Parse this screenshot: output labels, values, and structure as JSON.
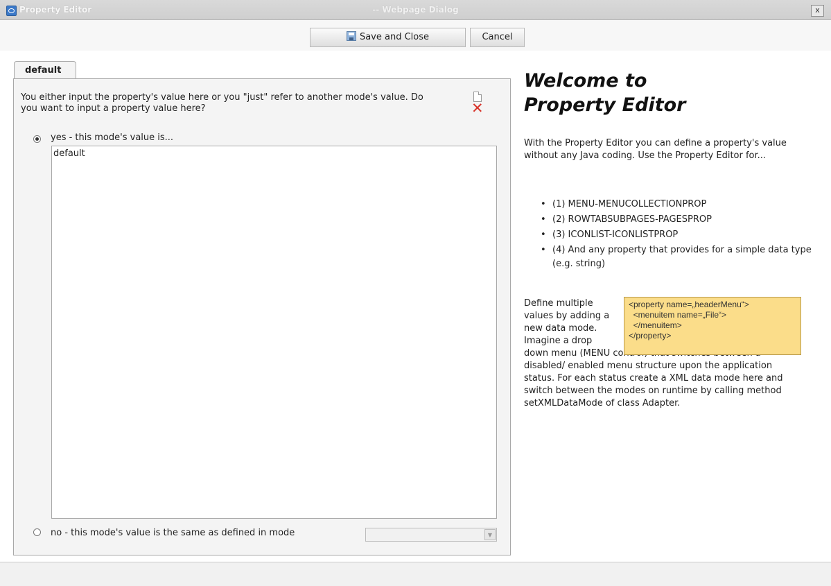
{
  "window": {
    "app_title": "Property Editor",
    "dialog_title": "-- Webpage Dialog",
    "close_label": "x"
  },
  "toolbar": {
    "save_label": "Save and Close",
    "cancel_label": "Cancel"
  },
  "tab": {
    "label": "default"
  },
  "editor": {
    "question": "You either input the property's value here or you \"just\" refer to another mode's value. Do you want to input a property value here?",
    "yes_label": "yes - this mode's value is...",
    "value": "default",
    "no_label": "no - this mode's value is the same as defined in mode",
    "mode_select_value": ""
  },
  "help": {
    "title_line1": "Welcome to",
    "title_line2": "Property Editor",
    "intro": "With the Property Editor you can define a property's value without any Java coding. Use the Property Editor for...",
    "uses": [
      "(1) MENU-MENUCOLLECTIONPROP",
      "(2) ROWTABSUBPAGES-PAGESPROP",
      "(3) ICONLIST-ICONLISTPROP",
      "(4) And any property that provides for a simple data type (e.g. string)"
    ],
    "define_short": "Define multiple values by adding a new data mode. Imagine a drop",
    "define_long": "down menu (MENU control) that switches between a disabled/ enabled menu structure upon the application status. For each status create a XML data mode here and switch between the modes on runtime by calling method setXMLDataMode of class Adapter.",
    "xml_lines": [
      "<property name=„headerMenu“>",
      "  <menuitem name=„File“>",
      "  </menuitem>",
      "</property>"
    ]
  },
  "colors": {
    "xml_box_bg": "#fbdd8a",
    "delete_icon": "#d8332a",
    "panel_bg": "#f4f4f4"
  }
}
